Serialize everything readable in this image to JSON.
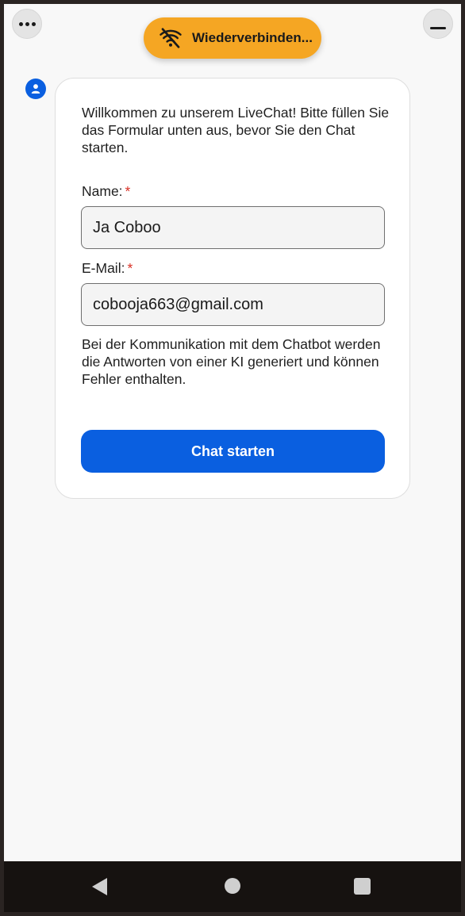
{
  "header": {
    "menu_icon": "more-horizontal-icon",
    "minimize_icon": "minimize-icon",
    "status": {
      "label": "Wiederverbinden...",
      "icon": "wifi-off-icon",
      "color": "#f5a623"
    }
  },
  "chat": {
    "avatar_icon": "user-icon",
    "intro": "Willkommen zu unserem LiveChat! Bitte füllen Sie das Formular unten aus, bevor Sie den Chat starten.",
    "form": {
      "name_label": "Name:",
      "name_value": "Ja Coboo",
      "email_label": "E-Mail:",
      "email_value": "cobooja663@gmail.com",
      "required_marker": "*"
    },
    "notice": "Bei der Kommunikation mit dem Chatbot werden die Antworten von einer KI generiert und können Fehler enthalten.",
    "start_button": "Chat starten",
    "accent_color": "#0a5fe0"
  },
  "navbar": {
    "back_icon": "back-triangle-icon",
    "home_icon": "home-circle-icon",
    "recent_icon": "recent-square-icon"
  }
}
